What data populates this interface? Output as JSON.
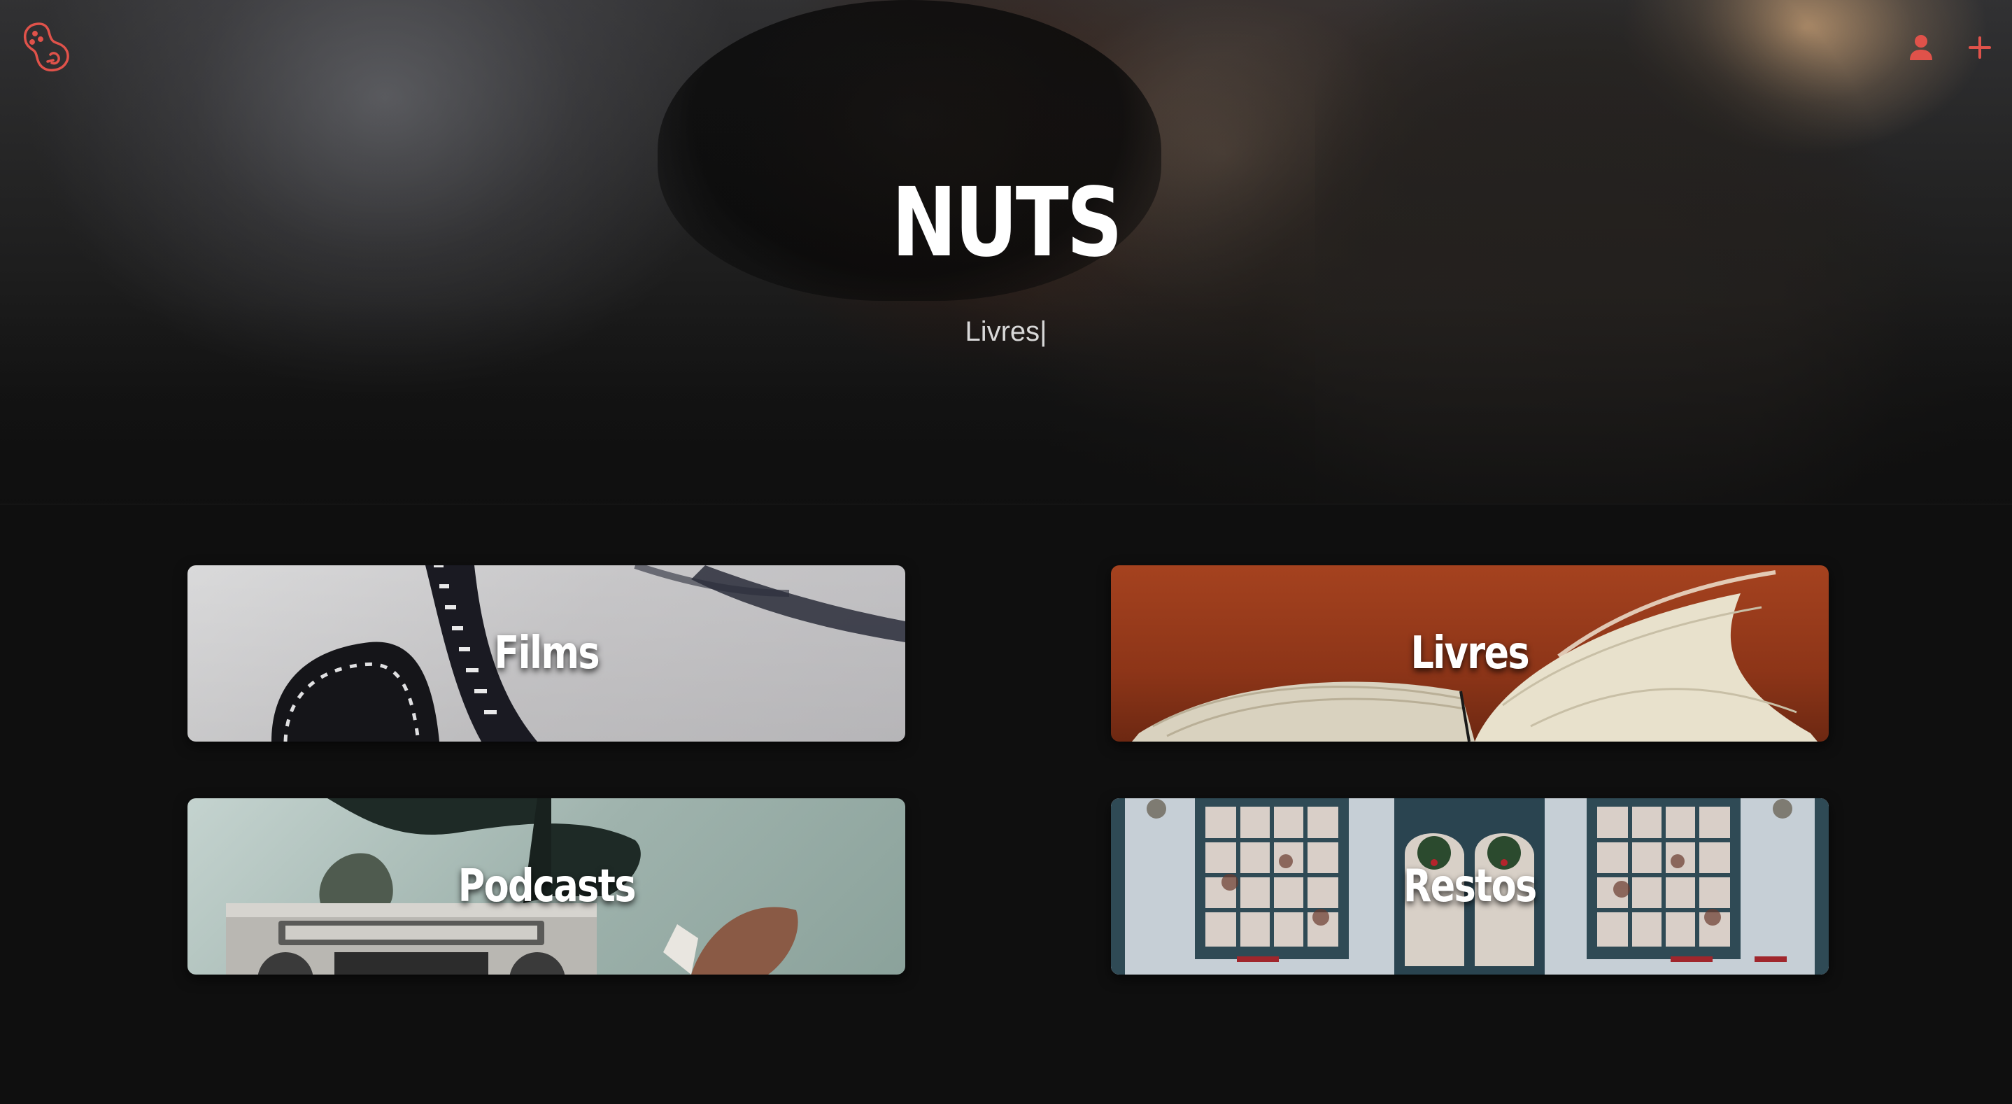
{
  "app": {
    "title": "NUTS",
    "tagline": "Livres",
    "caret": "|"
  },
  "header": {
    "logo_icon": "peanut-logo-icon",
    "actions": [
      {
        "icon": "user-icon"
      },
      {
        "icon": "plus-icon"
      }
    ]
  },
  "categories": [
    {
      "label": "Films",
      "image": "film-reel"
    },
    {
      "label": "Livres",
      "image": "open-book"
    },
    {
      "label": "Podcasts",
      "image": "boombox-radio"
    },
    {
      "label": "Restos",
      "image": "shop-front"
    }
  ],
  "colors": {
    "accent": "#e0524a",
    "background": "#0f0f0f",
    "text": "#ffffff"
  }
}
